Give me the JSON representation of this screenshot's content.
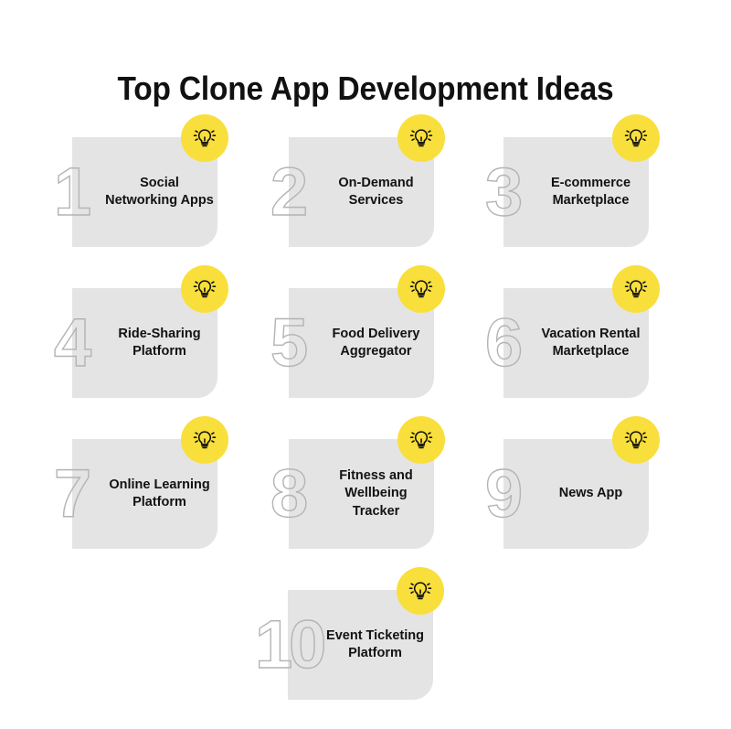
{
  "header": {
    "title": "Top Clone App Development Ideas"
  },
  "theme": {
    "background": "#ffffff",
    "card_background": "#e4e4e4",
    "badge_yellow": "#f9df3b",
    "number_outline": "#b4b4b4",
    "text_color": "#121212"
  },
  "badge": {
    "icon": "lightbulb-icon"
  },
  "rows": [
    {
      "cards": [
        {
          "number": "1",
          "label": "Social Networking Apps"
        },
        {
          "number": "2",
          "label": "On-Demand Services"
        },
        {
          "number": "3",
          "label": "E-commerce Marketplace"
        }
      ]
    },
    {
      "cards": [
        {
          "number": "4",
          "label": "Ride-Sharing Platform"
        },
        {
          "number": "5",
          "label": "Food Delivery Aggregator"
        },
        {
          "number": "6",
          "label": "Vacation Rental Marketplace"
        }
      ]
    },
    {
      "cards": [
        {
          "number": "7",
          "label": "Online Learning Platform"
        },
        {
          "number": "8",
          "label": "Fitness and Wellbeing Tracker"
        },
        {
          "number": "9",
          "label": "News App"
        }
      ]
    },
    {
      "cards": [
        {
          "number": "10",
          "label": "Event Ticketing Platform"
        }
      ]
    }
  ]
}
